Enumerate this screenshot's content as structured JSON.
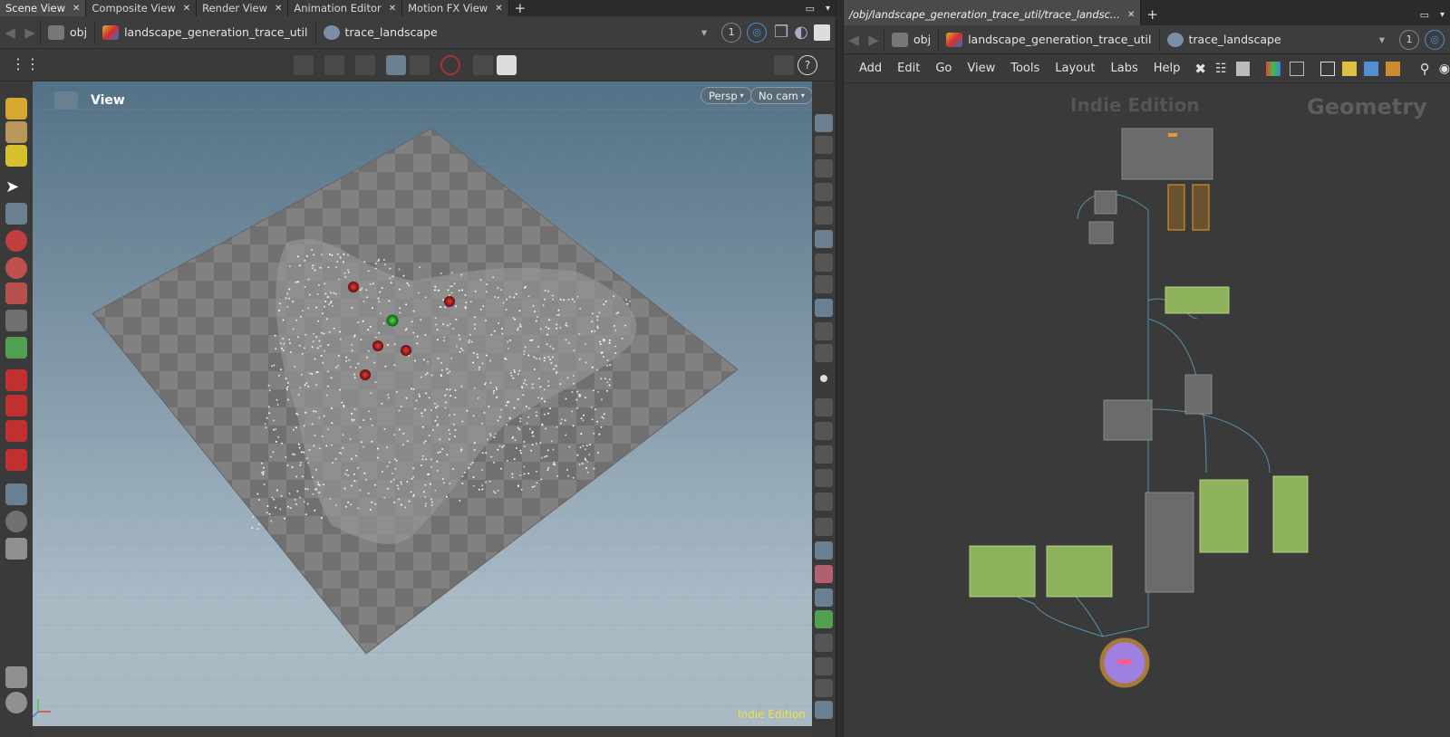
{
  "left": {
    "tabs": [
      {
        "label": "Scene View"
      },
      {
        "label": "Composite View"
      },
      {
        "label": "Render View"
      },
      {
        "label": "Animation Editor"
      },
      {
        "label": "Motion FX View"
      }
    ],
    "path": [
      "obj",
      "landscape_generation_trace_util",
      "trace_landscape"
    ],
    "frame_value": "1",
    "viewport": {
      "label": "View",
      "persp": "Persp",
      "cam": "No cam",
      "watermark": "Indie Edition"
    }
  },
  "right": {
    "tab": {
      "label": "/obj/landscape_generation_trace_util/trace_landsc..."
    },
    "path": [
      "obj",
      "landscape_generation_trace_util",
      "trace_landscape"
    ],
    "frame_value": "1",
    "menu": [
      "Add",
      "Edit",
      "Go",
      "View",
      "Tools",
      "Layout",
      "Labs",
      "Help"
    ],
    "network": {
      "watermark": "Indie Edition",
      "context": "Geometry"
    }
  },
  "colors": {
    "node_green": "#8fb35c",
    "node_gray": "#6b6b6b",
    "output_purple": "#9f7fe0",
    "accent_orange": "#e89b2a"
  }
}
